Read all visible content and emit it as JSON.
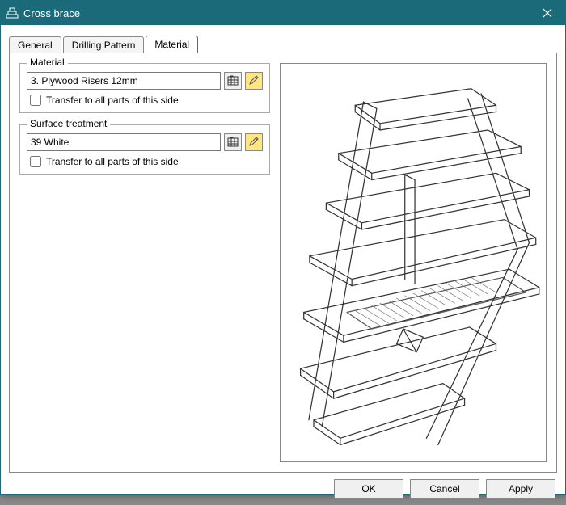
{
  "window": {
    "title": "Cross brace"
  },
  "tabs": {
    "general": "General",
    "drilling": "Drilling Pattern",
    "material": "Material",
    "active": "material"
  },
  "material_group": {
    "legend": "Material",
    "value": "3. Plywood Risers 12mm",
    "transfer_label": "Transfer to all parts of this side",
    "transfer_checked": false
  },
  "surface_group": {
    "legend": "Surface treatment",
    "value": "39 White",
    "transfer_label": "Transfer to all parts of this side",
    "transfer_checked": false
  },
  "buttons": {
    "ok": "OK",
    "cancel": "Cancel",
    "apply": "Apply"
  }
}
